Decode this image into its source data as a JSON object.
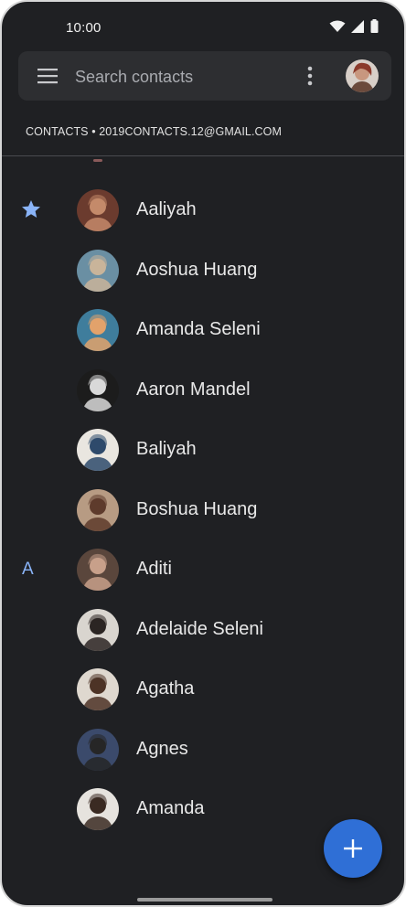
{
  "status_bar": {
    "time": "10:00",
    "icons": [
      "wifi-icon",
      "signal-icon",
      "battery-icon"
    ]
  },
  "search": {
    "placeholder": "Search contacts",
    "menu_icon": "menu-icon",
    "more_icon": "more-vert-icon"
  },
  "account": {
    "label": "CONTACTS • 2019CONTACTS.12@GMAIL.COM"
  },
  "contacts": [
    {
      "name": "Aaliyah",
      "marker": "★",
      "marker_icon": "star-icon",
      "avatar_colors": [
        "#6b3b2e",
        "#c48a6a"
      ]
    },
    {
      "name": "Aoshua Huang",
      "marker": "",
      "avatar_colors": [
        "#6a8fa3",
        "#c9b49a"
      ]
    },
    {
      "name": "Amanda Seleni",
      "marker": "",
      "avatar_colors": [
        "#3f7d9c",
        "#e2a26b"
      ]
    },
    {
      "name": "Aaron Mandel",
      "marker": "",
      "avatar_colors": [
        "#1c1c1c",
        "#d9d9d9"
      ]
    },
    {
      "name": "Baliyah",
      "marker": "",
      "avatar_colors": [
        "#e9e6e0",
        "#2e4a6b"
      ]
    },
    {
      "name": "Boshua Huang",
      "marker": "",
      "avatar_colors": [
        "#b79b83",
        "#5e3b2c"
      ]
    },
    {
      "name": "Aditi",
      "marker": "A",
      "avatar_colors": [
        "#5a463c",
        "#c8a08a"
      ]
    },
    {
      "name": "Adelaide Seleni",
      "marker": "",
      "avatar_colors": [
        "#d9d5cf",
        "#2b2523"
      ]
    },
    {
      "name": "Agatha",
      "marker": "",
      "avatar_colors": [
        "#dfd8cf",
        "#4d3326"
      ]
    },
    {
      "name": "Agnes",
      "marker": "",
      "avatar_colors": [
        "#3b4a6b",
        "#262626"
      ]
    },
    {
      "name": "Amanda",
      "marker": "",
      "avatar_colors": [
        "#e6e3de",
        "#3a2a22"
      ]
    }
  ],
  "fab": {
    "icon": "add-icon"
  },
  "colors": {
    "background": "#1f2023",
    "search_bar": "#2d2e31",
    "accent": "#8ab4f8",
    "fab": "#2f6fd6",
    "text": "#e8e8e8"
  }
}
